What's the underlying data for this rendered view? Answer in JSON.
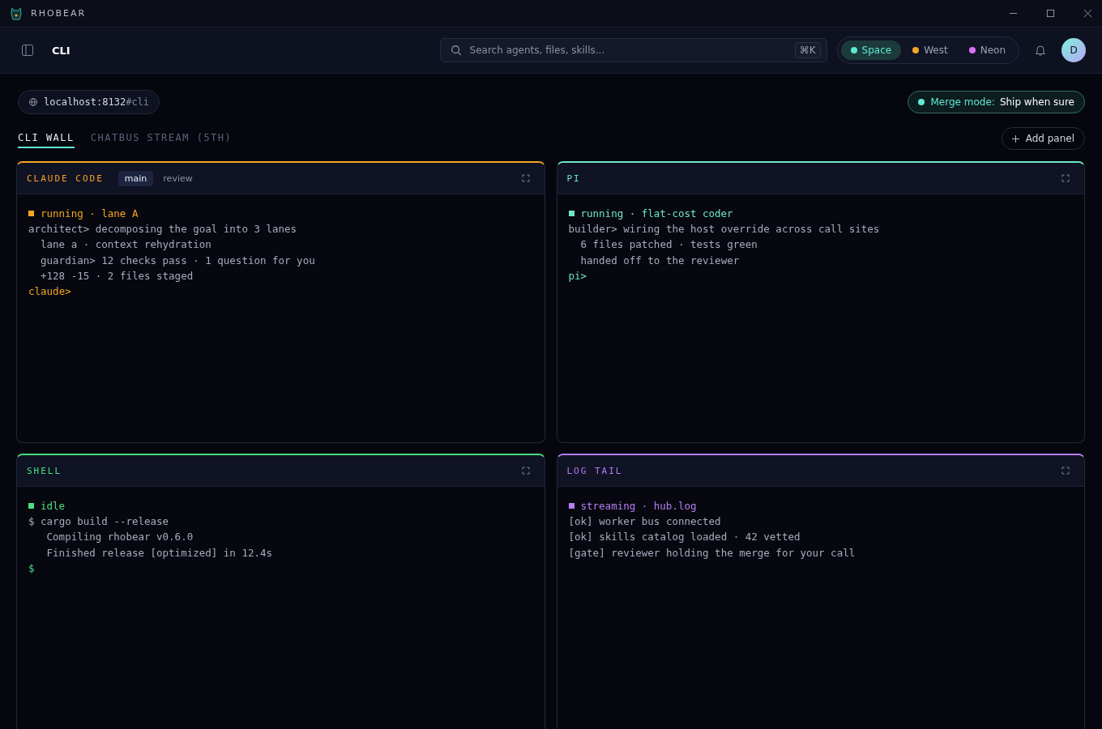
{
  "window": {
    "title": "RHOBEAR"
  },
  "header": {
    "title": "CLI",
    "search": {
      "placeholder": "Search agents, files, skills...",
      "shortcut": "⌘K"
    },
    "themes": [
      {
        "label": "Space",
        "color": "#5eead4",
        "selected": true
      },
      {
        "label": "West",
        "color": "#f5a524",
        "selected": false
      },
      {
        "label": "Neon",
        "color": "#d672f0",
        "selected": false
      }
    ],
    "avatar": "D"
  },
  "address": {
    "host": "localhost:8132",
    "hash": "#cli"
  },
  "merge_mode": {
    "label": "Merge mode:",
    "value": "Ship when sure"
  },
  "tabs": [
    {
      "label": "CLI WALL",
      "selected": true
    },
    {
      "label": "CHATBUS STREAM (5TH)",
      "selected": false
    }
  ],
  "add_panel": "Add panel",
  "panels": [
    {
      "title": "CLAUDE CODE",
      "color": "#f5a524",
      "tabs": [
        {
          "label": "main",
          "selected": true
        },
        {
          "label": "review",
          "selected": false
        }
      ],
      "lines": [
        {
          "kind": "status",
          "text": "running · lane A"
        },
        {
          "kind": "line",
          "text": "architect> decomposing the goal into 3 lanes"
        },
        {
          "kind": "detail",
          "text": "lane a · context rehydration"
        },
        {
          "kind": "detail",
          "text": "guardian> 12 checks pass · 1 question for you"
        },
        {
          "kind": "detail",
          "text": "+128 -15 · 2 files staged"
        },
        {
          "kind": "prompt",
          "text": "claude>"
        }
      ]
    },
    {
      "title": "PI",
      "color": "#6ee7c7",
      "lines": [
        {
          "kind": "status",
          "text": "running · flat-cost coder"
        },
        {
          "kind": "line",
          "text": "builder> wiring the host override across call sites"
        },
        {
          "kind": "detail",
          "text": "6 files patched · tests green"
        },
        {
          "kind": "detail",
          "text": "handed off to the reviewer"
        },
        {
          "kind": "prompt",
          "text": "pi>"
        }
      ]
    },
    {
      "title": "SHELL",
      "color": "#4ade80",
      "lines": [
        {
          "kind": "status",
          "text": "idle"
        },
        {
          "kind": "line",
          "text": "$ cargo build --release"
        },
        {
          "kind": "deep",
          "text": "Compiling rhobear v0.6.0"
        },
        {
          "kind": "deep",
          "text": "Finished release [optimized] in 12.4s"
        },
        {
          "kind": "prompt",
          "text": "$"
        }
      ]
    },
    {
      "title": "LOG TAIL",
      "color": "#b67cf5",
      "lines": [
        {
          "kind": "status",
          "text": "streaming · hub.log"
        },
        {
          "kind": "line",
          "text": "[ok] worker bus connected"
        },
        {
          "kind": "line",
          "text": "[ok] skills catalog loaded · 42 vetted"
        },
        {
          "kind": "line",
          "text": "[gate] reviewer holding the merge for your call"
        }
      ]
    }
  ]
}
